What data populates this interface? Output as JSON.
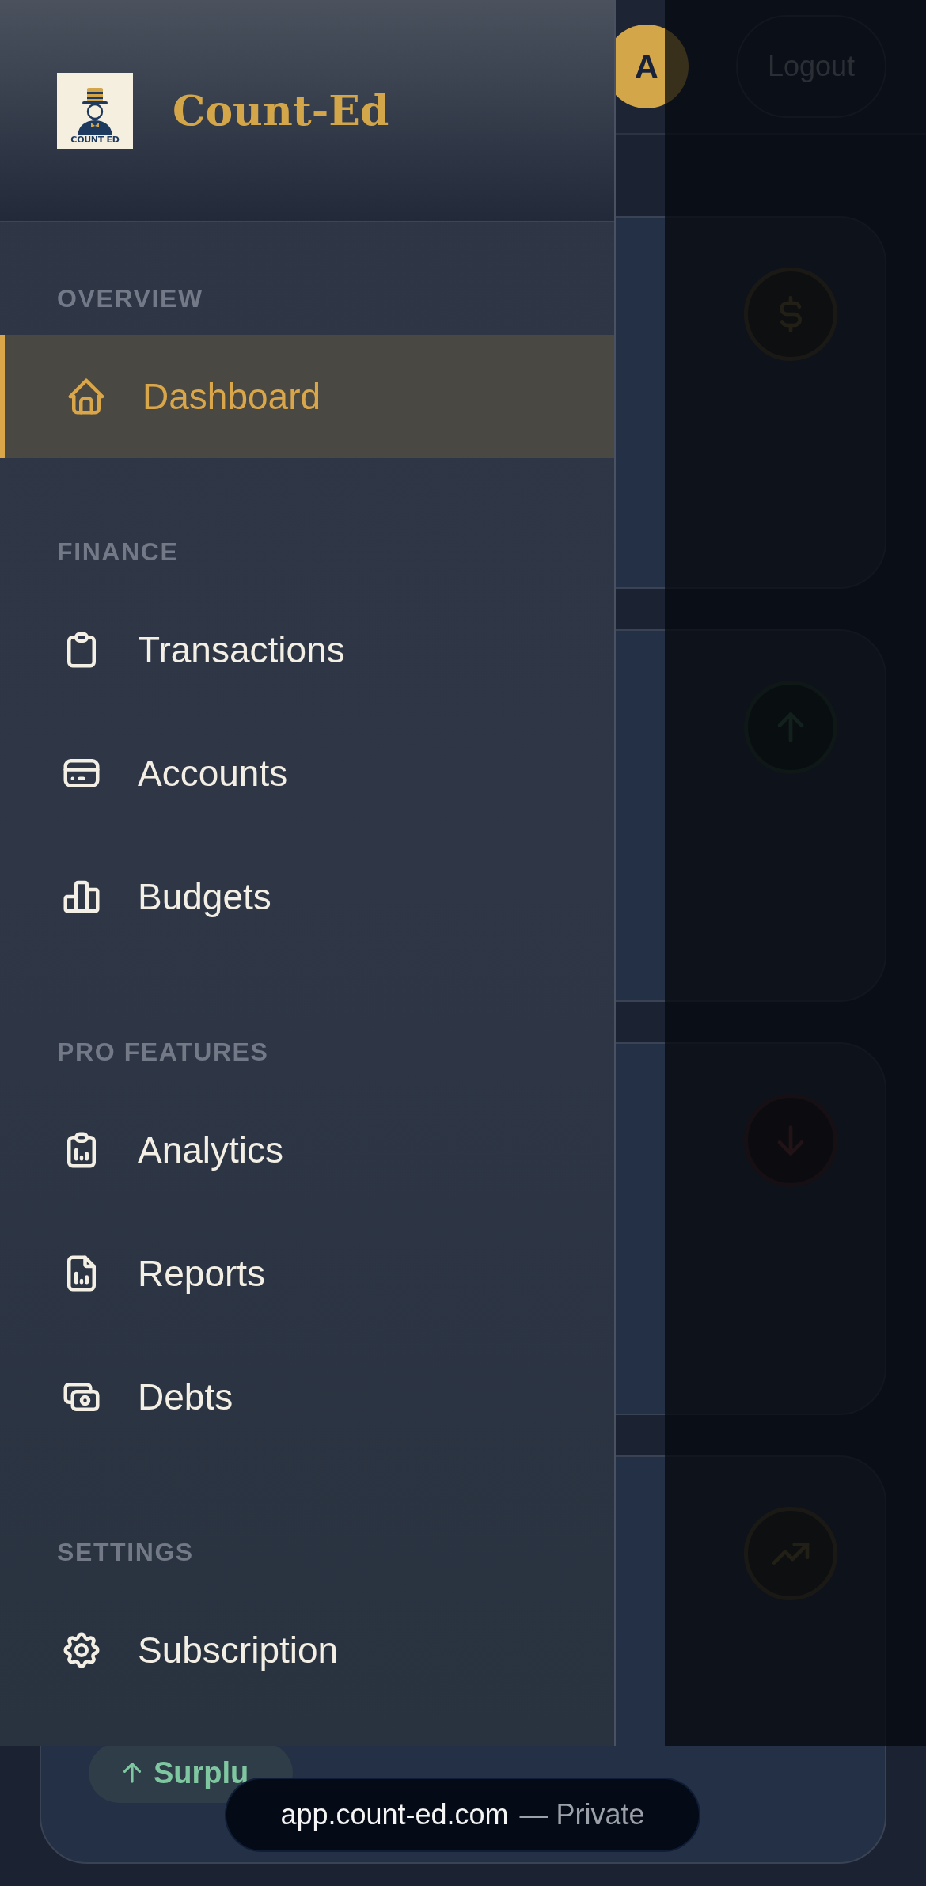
{
  "header": {
    "avatar": "A",
    "logout": "Logout"
  },
  "sidebar": {
    "brand": {
      "logo_text": "COUNT ED",
      "name": "Count-Ed"
    },
    "sections": [
      {
        "label": "OVERVIEW",
        "items": [
          {
            "label": "Dashboard",
            "selected": true
          }
        ]
      },
      {
        "label": "FINANCE",
        "items": [
          {
            "label": "Transactions",
            "selected": false
          },
          {
            "label": "Accounts",
            "selected": false
          },
          {
            "label": "Budgets",
            "selected": false
          }
        ]
      },
      {
        "label": "PRO FEATURES",
        "items": [
          {
            "label": "Analytics",
            "selected": false
          },
          {
            "label": "Reports",
            "selected": false
          },
          {
            "label": "Debts",
            "selected": false
          }
        ]
      },
      {
        "label": "SETTINGS",
        "items": [
          {
            "label": "Subscription",
            "selected": false
          }
        ]
      }
    ]
  },
  "summary_card": {
    "badge": "Surplu"
  },
  "url_bar": {
    "url": "app.count-ed.com",
    "label": "— Private"
  }
}
